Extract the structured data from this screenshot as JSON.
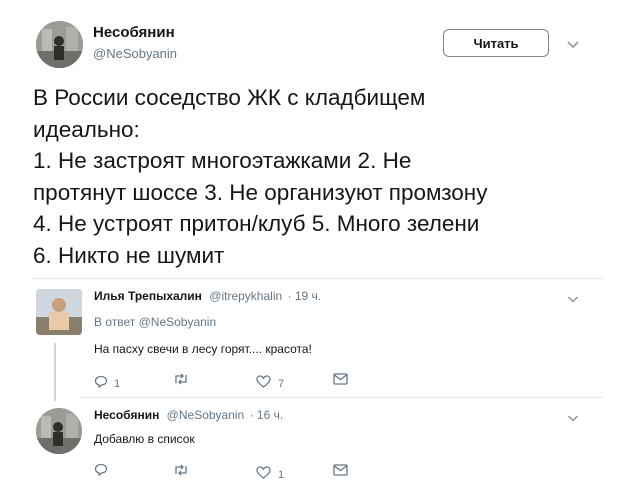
{
  "main_tweet": {
    "author_name": "Несобянин",
    "author_handle": "@NeSobyanin",
    "follow_label": "Читать",
    "text": "В России соседство ЖК с кладбищем\nидеально:\n1. Не застроят многоэтажками 2. Не\nпротянут шоссе 3. Не организуют промзону\n4. Не устроят притон/клуб 5. Много зелени\n6. Никто не шумит"
  },
  "replies": [
    {
      "author_name": "Илья Трепыхалин",
      "author_handle": "@itrepykhalin",
      "time": "· 19 ч.",
      "reply_to": "В ответ @NeSobyanin",
      "text": "На пасху свечи в лесу горят.... красота!",
      "reply_count": "1",
      "retweet_count": "",
      "like_count": "7"
    },
    {
      "author_name": "Несобянин",
      "author_handle": "@NeSobyanin",
      "time": "· 16 ч.",
      "text": "Добавлю в список",
      "reply_count": "",
      "retweet_count": "",
      "like_count": "1"
    }
  ],
  "icons": {
    "dropdown": "chevron-down-icon",
    "reply": "reply-icon",
    "retweet": "retweet-icon",
    "like": "heart-icon",
    "dm": "envelope-icon"
  },
  "colors": {
    "text": "#14171a",
    "muted": "#657786",
    "divider": "#e1e8ed"
  }
}
